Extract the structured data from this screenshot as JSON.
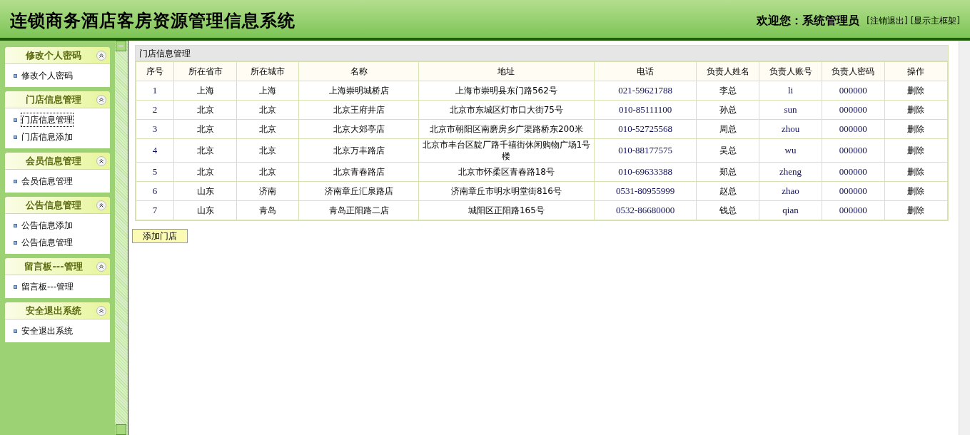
{
  "header": {
    "title": "连锁商务酒店客房资源管理信息系统",
    "welcome": "欢迎您：系统管理员",
    "links": [
      "[注销退出]",
      "[显示主框架]"
    ]
  },
  "sidebar": [
    {
      "title": "修改个人密码",
      "expanded": true,
      "items": [
        {
          "label": "修改个人密码",
          "selected": false
        }
      ]
    },
    {
      "title": "门店信息管理",
      "expanded": true,
      "items": [
        {
          "label": "门店信息管理",
          "selected": true
        },
        {
          "label": "门店信息添加",
          "selected": false
        }
      ]
    },
    {
      "title": "会员信息管理",
      "expanded": true,
      "items": [
        {
          "label": "会员信息管理",
          "selected": false
        }
      ]
    },
    {
      "title": "公告信息管理",
      "expanded": true,
      "items": [
        {
          "label": "公告信息添加",
          "selected": false
        },
        {
          "label": "公告信息管理",
          "selected": false
        }
      ]
    },
    {
      "title": "留言板---管理",
      "expanded": true,
      "items": [
        {
          "label": "留言板---管理",
          "selected": false
        }
      ]
    },
    {
      "title": "安全退出系统",
      "expanded": true,
      "items": [
        {
          "label": "安全退出系统",
          "selected": false
        }
      ]
    }
  ],
  "table": {
    "title": "门店信息管理",
    "columns": [
      "序号",
      "所在省市",
      "所在城市",
      "名称",
      "地址",
      "电话",
      "负责人姓名",
      "负责人账号",
      "负责人密码",
      "操作"
    ],
    "rows": [
      [
        "1",
        "上海",
        "上海",
        "上海崇明城桥店",
        "上海市崇明县东门路562号",
        "021-59621788",
        "李总",
        "li",
        "000000",
        "删除"
      ],
      [
        "2",
        "北京",
        "北京",
        "北京王府井店",
        "北京市东城区灯市口大街75号",
        "010-85111100",
        "孙总",
        "sun",
        "000000",
        "删除"
      ],
      [
        "3",
        "北京",
        "北京",
        "北京大郊亭店",
        "北京市朝阳区南磨房乡广渠路桥东200米",
        "010-52725568",
        "周总",
        "zhou",
        "000000",
        "删除"
      ],
      [
        "4",
        "北京",
        "北京",
        "北京万丰路店",
        "北京市丰台区靛厂路千禧街休闲购物广场1号楼",
        "010-88177575",
        "吴总",
        "wu",
        "000000",
        "删除"
      ],
      [
        "5",
        "北京",
        "北京",
        "北京青春路店",
        "北京市怀柔区青春路18号",
        "010-69633388",
        "郑总",
        "zheng",
        "000000",
        "删除"
      ],
      [
        "6",
        "山东",
        "济南",
        "济南章丘汇泉路店",
        "济南章丘市明水明堂街816号",
        "0531-80955999",
        "赵总",
        "zhao",
        "000000",
        "删除"
      ],
      [
        "7",
        "山东",
        "青岛",
        "青岛正阳路二店",
        "城阳区正阳路165号",
        "0532-86680000",
        "钱总",
        "qian",
        "000000",
        "删除"
      ]
    ]
  },
  "add_button": "添加门店"
}
